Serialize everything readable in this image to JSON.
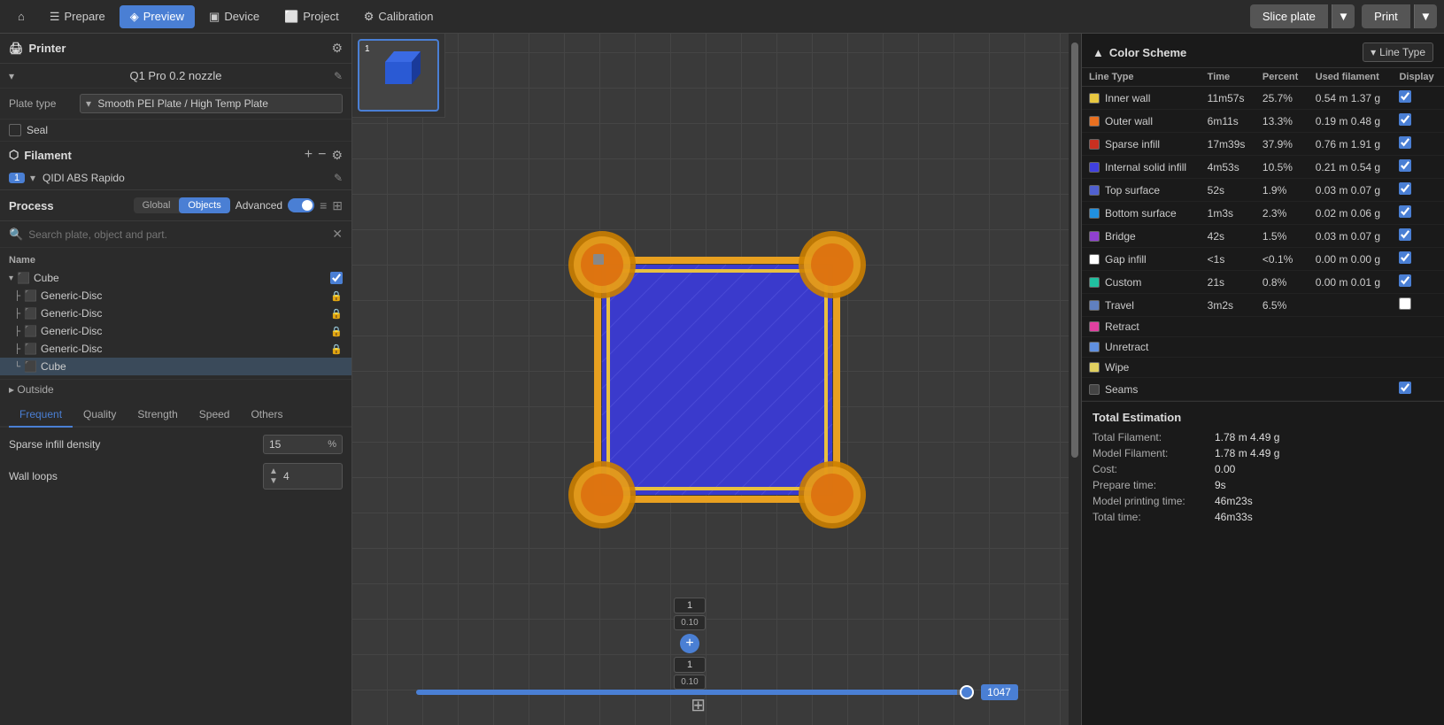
{
  "nav": {
    "home_icon": "⌂",
    "prepare_label": "Prepare",
    "preview_label": "Preview",
    "device_label": "Device",
    "project_label": "Project",
    "calibration_label": "Calibration",
    "slice_label": "Slice plate",
    "print_label": "Print"
  },
  "printer": {
    "section_title": "Printer",
    "printer_name": "Q1 Pro 0.2 nozzle",
    "plate_label": "Plate type",
    "plate_value": "Smooth PEI Plate / High Temp Plate",
    "seal_label": "Seal"
  },
  "filament": {
    "section_title": "Filament",
    "item_num": "1",
    "item_name": "QIDI ABS Rapido"
  },
  "process": {
    "section_title": "Process",
    "global_label": "Global",
    "objects_label": "Objects",
    "advanced_label": "Advanced",
    "search_placeholder": "Search plate, object and part."
  },
  "tree": {
    "name_label": "Name",
    "cube_label": "Cube",
    "disc1": "Generic-Disc",
    "disc2": "Generic-Disc",
    "disc3": "Generic-Disc",
    "disc4": "Generic-Disc",
    "cube_child": "Cube",
    "outside_label": "Outside"
  },
  "tabs": {
    "frequent": "Frequent",
    "quality": "Quality",
    "strength": "Strength",
    "speed": "Speed",
    "others": "Others"
  },
  "params": {
    "sparse_infill_label": "Sparse infill density",
    "sparse_infill_value": "15",
    "sparse_infill_unit": "%",
    "wall_loops_label": "Wall loops",
    "wall_loops_value": "4"
  },
  "color_scheme": {
    "title": "Color Scheme",
    "scheme_label": "Line Type",
    "columns": [
      "Line Type",
      "Time",
      "Percent",
      "Used filament",
      "Display"
    ],
    "rows": [
      {
        "color": "#e8c840",
        "name": "Inner wall",
        "time": "11m57s",
        "percent": "25.7%",
        "filament": "0.54 m  1.37 g",
        "checked": true
      },
      {
        "color": "#e87020",
        "name": "Outer wall",
        "time": "6m11s",
        "percent": "13.3%",
        "filament": "0.19 m  0.48 g",
        "checked": true
      },
      {
        "color": "#c83020",
        "name": "Sparse infill",
        "time": "17m39s",
        "percent": "37.9%",
        "filament": "0.76 m  1.91 g",
        "checked": true
      },
      {
        "color": "#4040e0",
        "name": "Internal solid infill",
        "time": "4m53s",
        "percent": "10.5%",
        "filament": "0.21 m  0.54 g",
        "checked": true
      },
      {
        "color": "#5060d0",
        "name": "Top surface",
        "time": "52s",
        "percent": "1.9%",
        "filament": "0.03 m  0.07 g",
        "checked": true
      },
      {
        "color": "#2090e0",
        "name": "Bottom surface",
        "time": "1m3s",
        "percent": "2.3%",
        "filament": "0.02 m  0.06 g",
        "checked": true
      },
      {
        "color": "#9040d0",
        "name": "Bridge",
        "time": "42s",
        "percent": "1.5%",
        "filament": "0.03 m  0.07 g",
        "checked": true
      },
      {
        "color": "#ffffff",
        "name": "Gap infill",
        "time": "<1s",
        "percent": "<0.1%",
        "filament": "0.00 m  0.00 g",
        "checked": true
      },
      {
        "color": "#20c0a0",
        "name": "Custom",
        "time": "21s",
        "percent": "0.8%",
        "filament": "0.00 m  0.01 g",
        "checked": true
      },
      {
        "color": "#6080c0",
        "name": "Travel",
        "time": "3m2s",
        "percent": "6.5%",
        "filament": "",
        "checked": false
      },
      {
        "color": "#e040a0",
        "name": "Retract",
        "time": "",
        "percent": "",
        "filament": "",
        "checked": false
      },
      {
        "color": "#6090e0",
        "name": "Unretract",
        "time": "",
        "percent": "",
        "filament": "",
        "checked": false
      },
      {
        "color": "#e0d060",
        "name": "Wipe",
        "time": "",
        "percent": "",
        "filament": "",
        "checked": false
      },
      {
        "color": "#444444",
        "name": "Seams",
        "time": "",
        "percent": "",
        "filament": "",
        "checked": true
      }
    ]
  },
  "estimation": {
    "title": "Total Estimation",
    "total_filament_label": "Total Filament:",
    "total_filament_value": "1.78 m  4.49 g",
    "model_filament_label": "Model Filament:",
    "model_filament_value": "1.78 m  4.49 g",
    "cost_label": "Cost:",
    "cost_value": "0.00",
    "prepare_label": "Prepare time:",
    "prepare_value": "9s",
    "model_print_label": "Model printing time:",
    "model_print_value": "46m23s",
    "total_time_label": "Total time:",
    "total_time_value": "46m33s"
  },
  "layer": {
    "slider_value": 1047,
    "box1_val": "1",
    "box1_sub": "0.10",
    "box2_val": "1",
    "box2_sub": "0.10"
  },
  "thumbnail": {
    "num": "1"
  }
}
